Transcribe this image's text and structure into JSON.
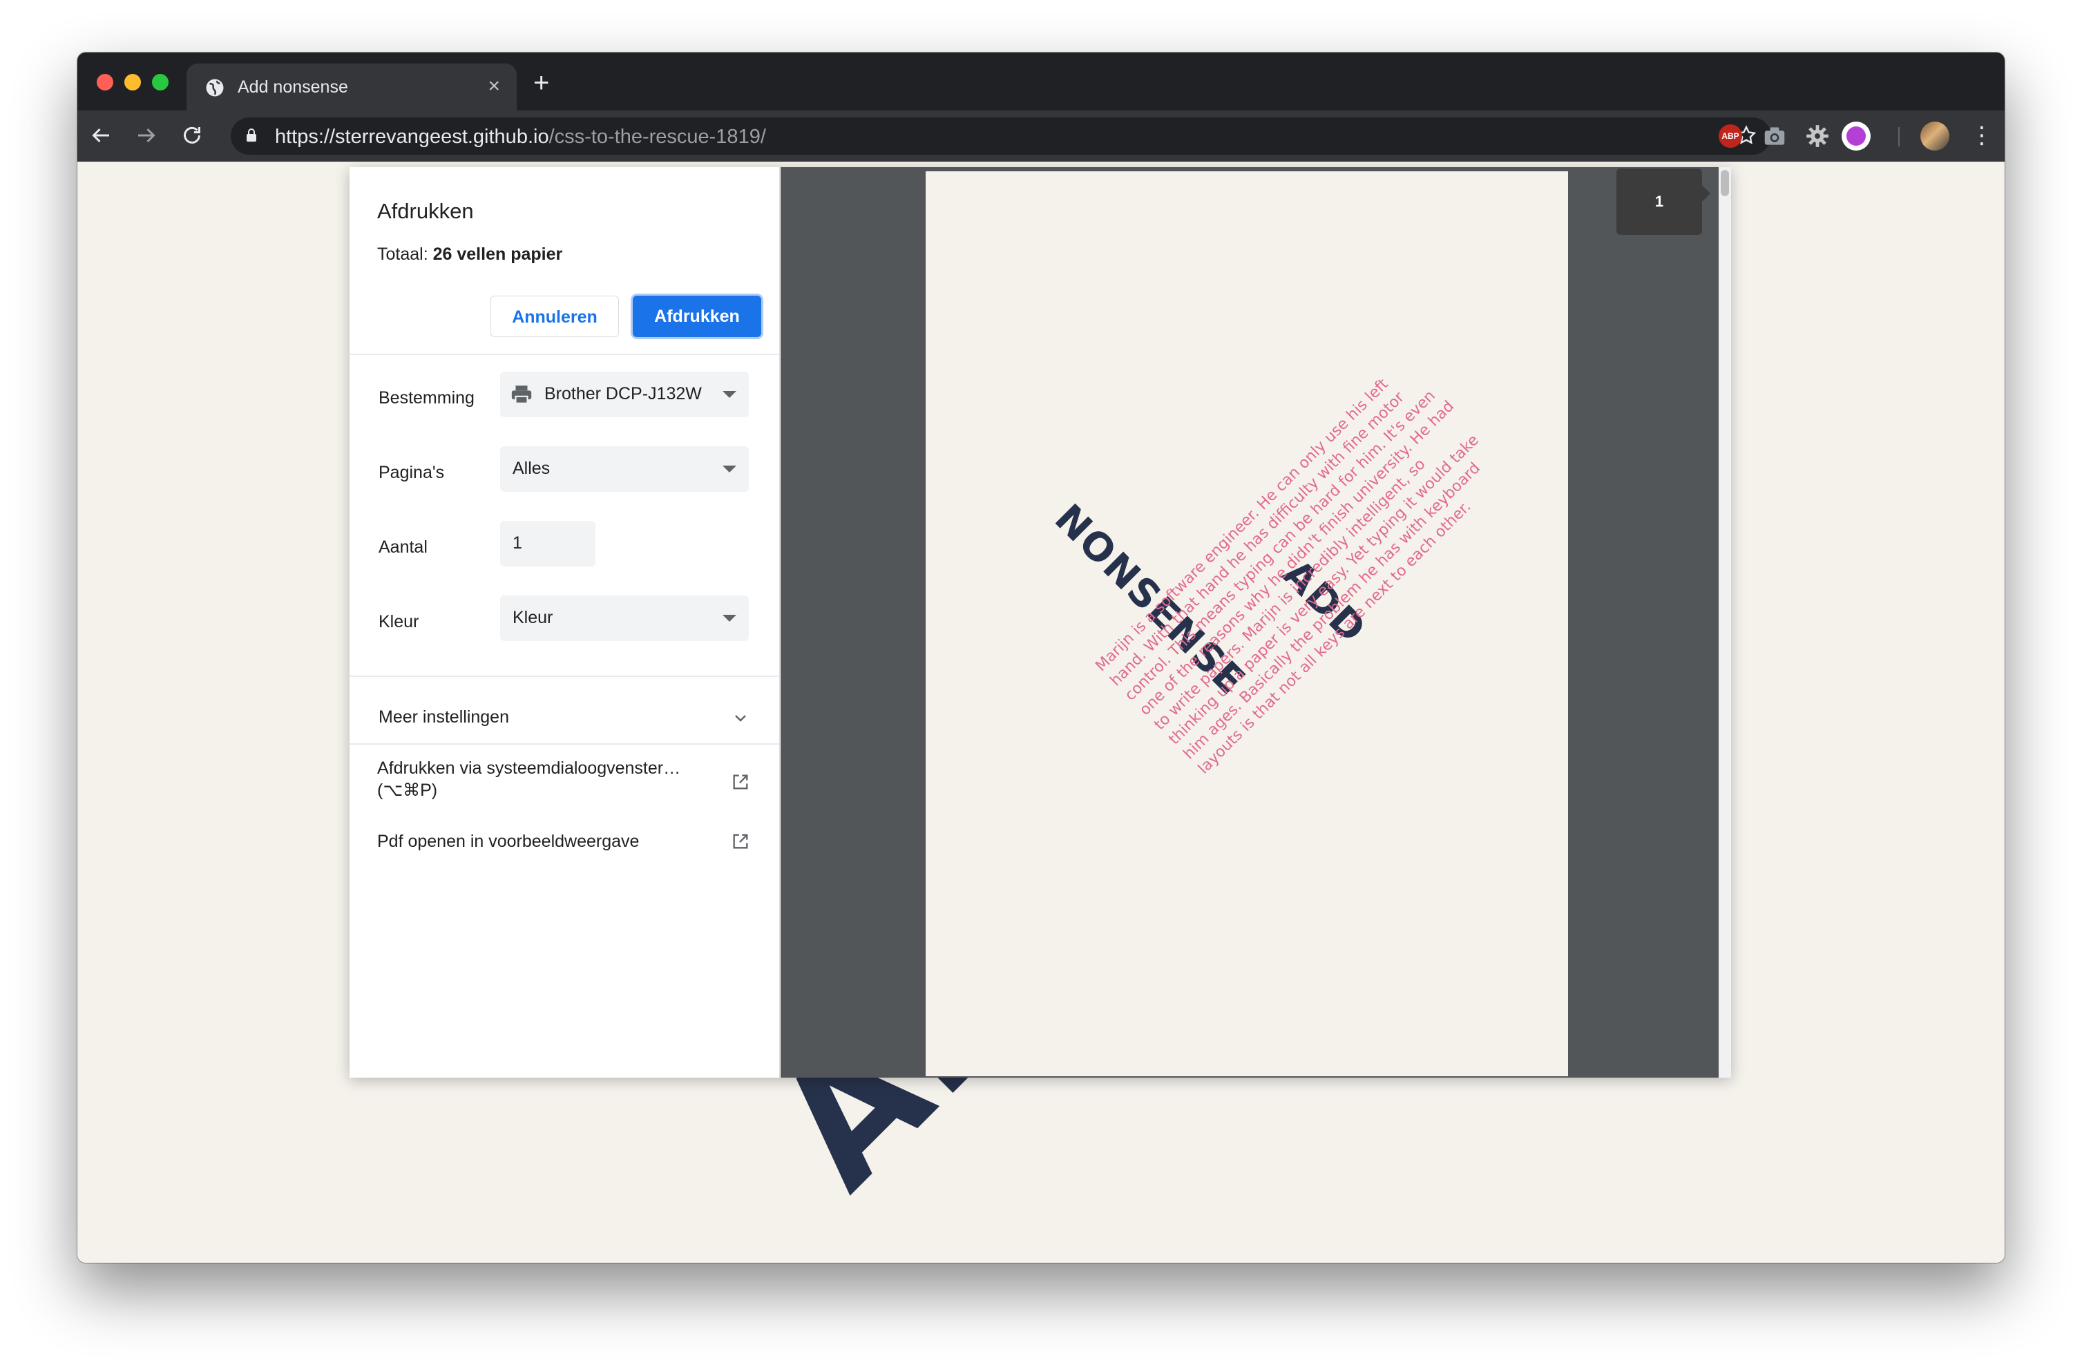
{
  "browser": {
    "tab_title": "Add nonsense",
    "tab_close": "×",
    "new_tab": "+",
    "url_host": "https://sterrevangeest.github.io",
    "url_path": "/css-to-the-rescue-1819/",
    "abp_label": "ABP",
    "menu": "⋮"
  },
  "print_dialog": {
    "title": "Afdrukken",
    "total_prefix": "Totaal:",
    "total_value": "26 vellen papier",
    "cancel_label": "Annuleren",
    "print_label": "Afdrukken",
    "settings": [
      {
        "label": "Bestemming",
        "value": "Brother DCP-J132W",
        "type": "select-printer"
      },
      {
        "label": "Pagina's",
        "value": "Alles",
        "type": "select"
      },
      {
        "label": "Aantal",
        "value": "1",
        "type": "number"
      },
      {
        "label": "Kleur",
        "value": "Kleur",
        "type": "select"
      }
    ],
    "more_settings": "Meer instellingen",
    "system_dialog_line1": "Afdrukken via systeemdialoogvenster…",
    "system_dialog_line2": "(⌥⌘P)",
    "open_pdf": "Pdf openen in voorbeeldweergave",
    "page_number": "1"
  },
  "page": {
    "heading_add": "ADD",
    "heading_nonsense": "NONSENSE",
    "background_add": "ADD",
    "body": "Marijn is a software engineer. He can only use his left hand. With that hand he has difficulty with fine motor control. This means typing can be hard for him. It's even one of the reasons why he didn't finish university. He had to write papers. Marijn is incredibly intelligent, so thinking up a paper is very easy. Yet typing it would take him ages. Basically the problem he has with keyboard layouts is that not all keys are next to each other."
  },
  "colors": {
    "accent": "#1a73e8",
    "heading": "#26314b",
    "body_text": "#e26a90",
    "page_bg": "#f5f2ec"
  }
}
